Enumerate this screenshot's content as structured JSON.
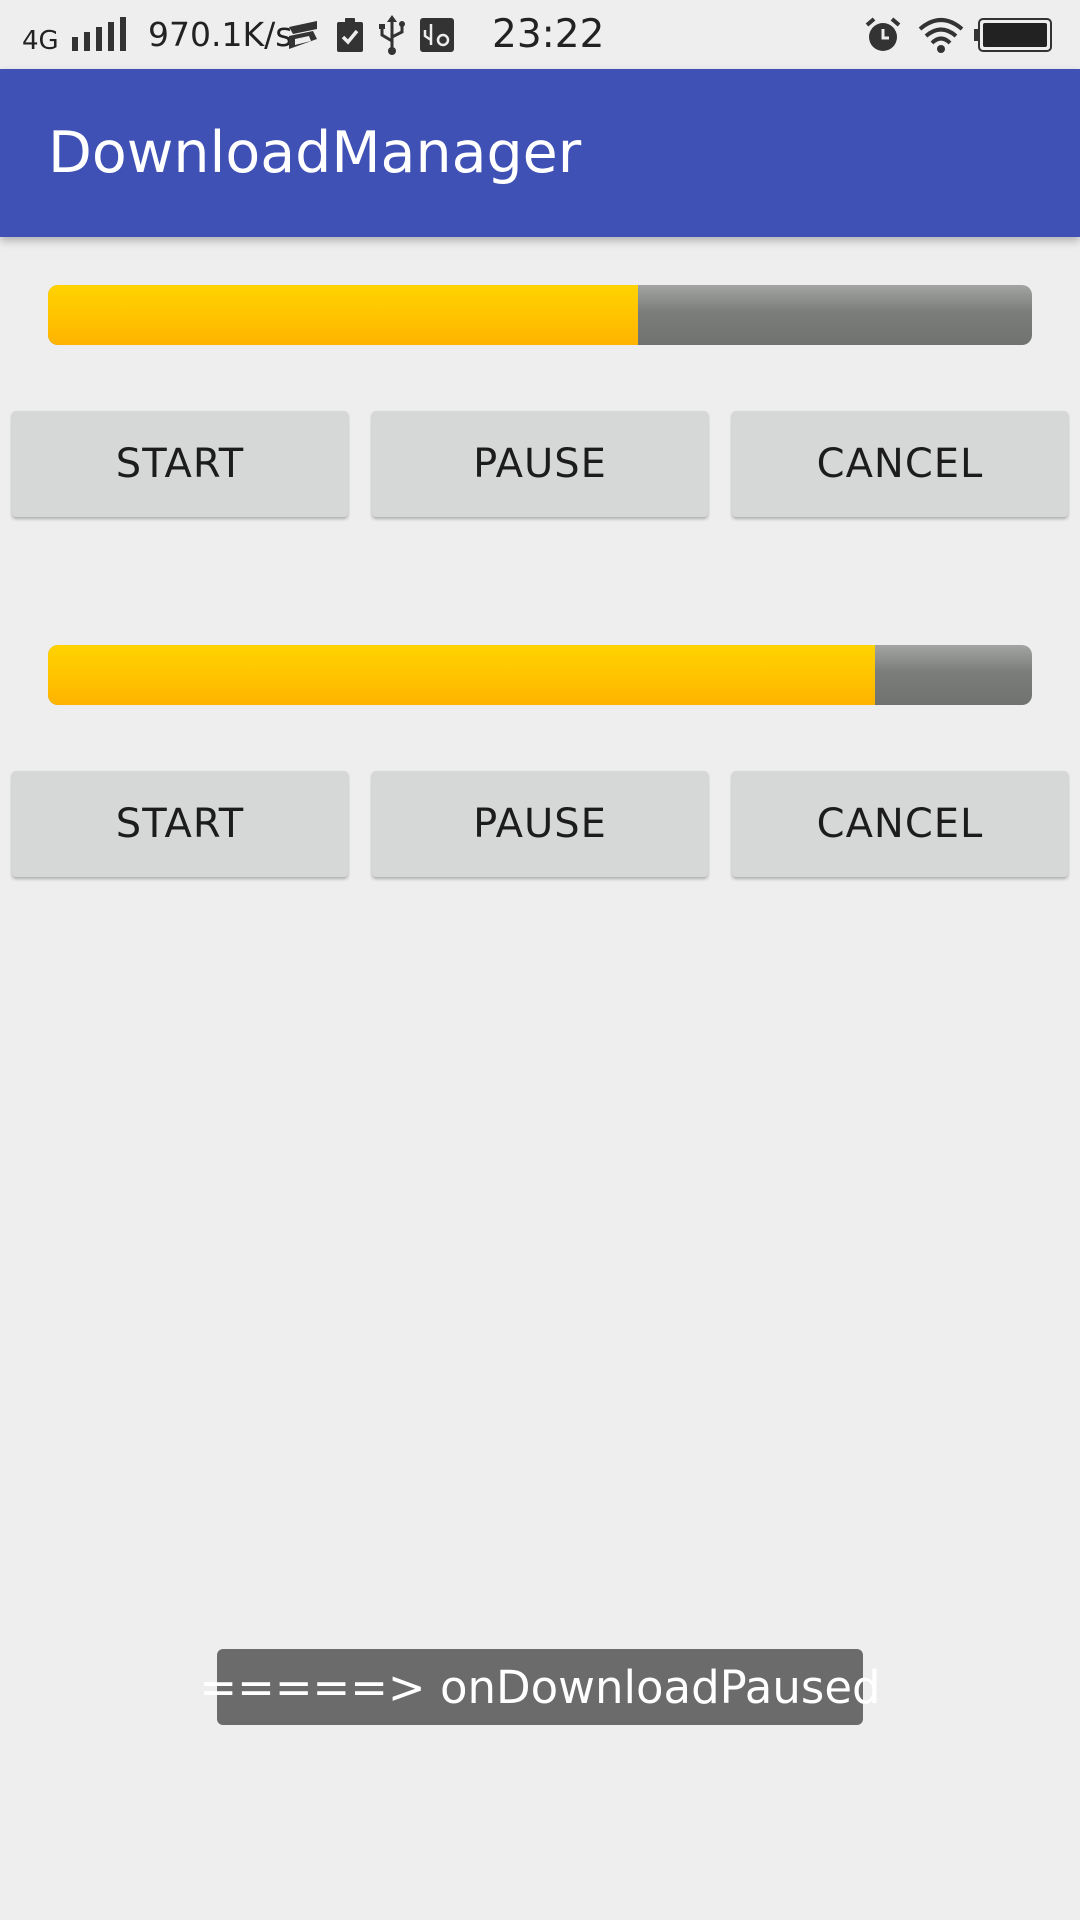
{
  "status_bar": {
    "network_type": "4G",
    "speed": "970.1K/s",
    "time": "23:22",
    "icons": [
      "signal-icon",
      "sogou-icon",
      "clipboard-check-icon",
      "usb-icon",
      "usb-settings-icon",
      "alarm-icon",
      "wifi-icon",
      "battery-icon"
    ]
  },
  "app_bar": {
    "title": "DownloadManager",
    "color": "#3f51b5"
  },
  "downloads": [
    {
      "progress_percent": 60,
      "buttons": {
        "start": "START",
        "pause": "PAUSE",
        "cancel": "CANCEL"
      }
    },
    {
      "progress_percent": 84,
      "buttons": {
        "start": "START",
        "pause": "PAUSE",
        "cancel": "CANCEL"
      }
    }
  ],
  "toast": {
    "message": "=====> onDownloadPaused"
  },
  "colors": {
    "progress_fill": "#ffc400",
    "progress_track": "#7a7d7a",
    "button_bg": "#d6d7d7",
    "background": "#eeeeee"
  }
}
